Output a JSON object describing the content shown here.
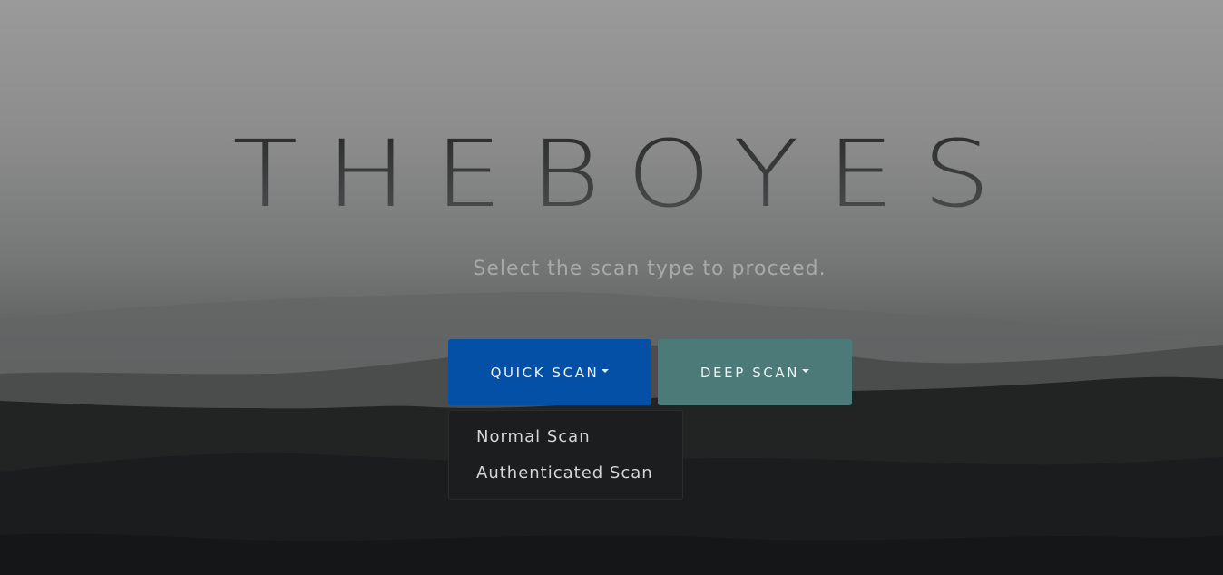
{
  "hero": {
    "title": "THEBOYES",
    "subtitle": "Select the scan type to proceed."
  },
  "buttons": {
    "quick_scan_label": "QUICK SCAN",
    "deep_scan_label": "DEEP SCAN"
  },
  "quick_scan_menu": {
    "items": [
      {
        "label": "Normal Scan"
      },
      {
        "label": "Authenticated Scan"
      }
    ]
  },
  "colors": {
    "quick_scan_button": "#0450a6",
    "deep_scan_button": "#4b7a78",
    "dropdown_background": "#1c1d1f",
    "subtitle_text": "#a9a9a9"
  }
}
